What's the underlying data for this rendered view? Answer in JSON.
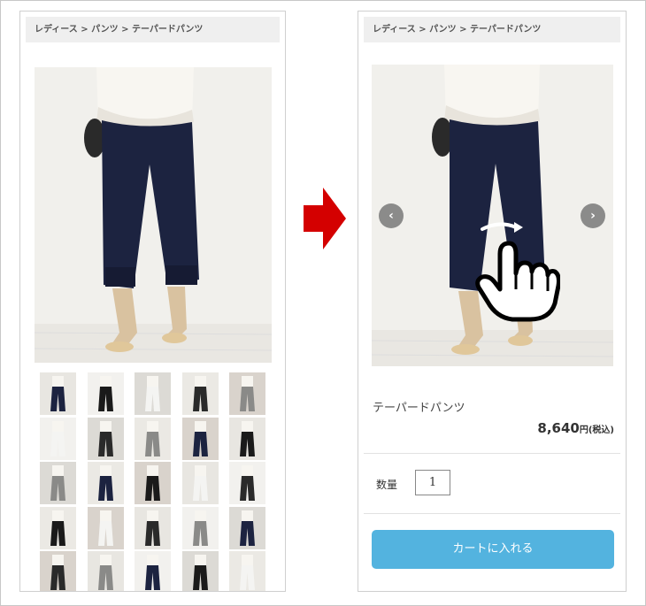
{
  "breadcrumb": {
    "text": "レディース > パンツ > テーパードパンツ"
  },
  "product": {
    "name": "テーパードパンツ",
    "price": "8,640",
    "price_suffix": "円(税込)"
  },
  "quantity": {
    "label": "数量",
    "value": "1"
  },
  "cart_button": {
    "label": "カートに入れる"
  },
  "carousel": {
    "prev_icon": "chevron-left-icon",
    "next_icon": "chevron-right-icon",
    "prev_glyph": "‹",
    "next_glyph": "›"
  },
  "colors": {
    "arrow": "#d40000",
    "cart_button": "#53b3df",
    "pants": "#1c2340",
    "top": "#f7f5f0",
    "wall": "#f0efeb"
  },
  "thumbnails": {
    "rows": 5,
    "cols": 5
  }
}
